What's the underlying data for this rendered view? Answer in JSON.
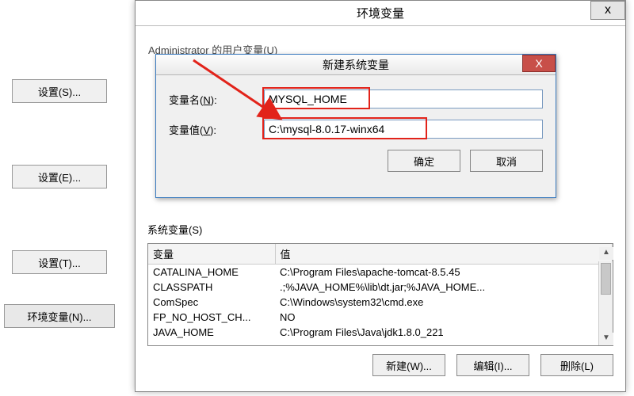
{
  "left_buttons": {
    "settings_s": "设置(S)...",
    "settings_e": "设置(E)...",
    "settings_t": "设置(T)...",
    "env_n": "环境变量(N)..."
  },
  "env_window": {
    "title": "环境变量",
    "close": "x",
    "user_vars_truncated": "Administrator 的用户变量(U)"
  },
  "newvar": {
    "title": "新建系统变量",
    "close": "X",
    "name_label_pre": "变量名(",
    "name_label_u": "N",
    "name_label_post": "):",
    "value_label_pre": "变量值(",
    "value_label_u": "V",
    "value_label_post": "):",
    "name_value": "MYSQL_HOME",
    "value_value": "C:\\mysql-8.0.17-winx64",
    "ok": "确定",
    "cancel": "取消"
  },
  "sysvars": {
    "section_label": "系统变量(S)",
    "col_var": "变量",
    "col_val": "值",
    "rows": [
      {
        "name": "CATALINA_HOME",
        "value": "C:\\Program Files\\apache-tomcat-8.5.45"
      },
      {
        "name": "CLASSPATH",
        "value": ".;%JAVA_HOME%\\lib\\dt.jar;%JAVA_HOME..."
      },
      {
        "name": "ComSpec",
        "value": "C:\\Windows\\system32\\cmd.exe"
      },
      {
        "name": "FP_NO_HOST_CH...",
        "value": "NO"
      },
      {
        "name": "JAVA_HOME",
        "value": "C:\\Program Files\\Java\\jdk1.8.0_221"
      }
    ],
    "btn_new": "新建(W)...",
    "btn_edit": "编辑(I)...",
    "btn_delete": "删除(L)"
  }
}
